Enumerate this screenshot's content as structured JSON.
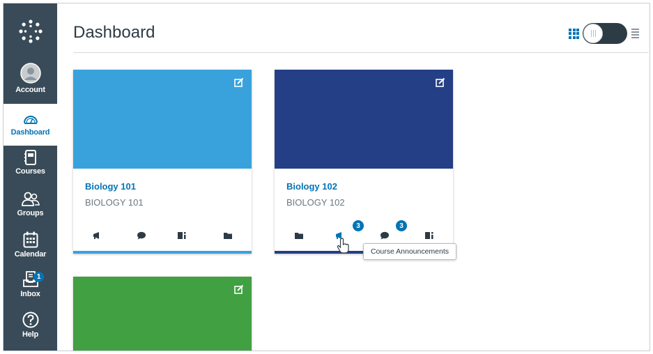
{
  "nav": {
    "items": [
      {
        "key": "account",
        "label": "Account",
        "icon": "account-icon"
      },
      {
        "key": "dashboard",
        "label": "Dashboard",
        "icon": "dashboard-icon",
        "active": true
      },
      {
        "key": "courses",
        "label": "Courses",
        "icon": "courses-icon"
      },
      {
        "key": "groups",
        "label": "Groups",
        "icon": "groups-icon"
      },
      {
        "key": "calendar",
        "label": "Calendar",
        "icon": "calendar-icon"
      },
      {
        "key": "inbox",
        "label": "Inbox",
        "icon": "inbox-icon",
        "badge": "1"
      },
      {
        "key": "help",
        "label": "Help",
        "icon": "help-icon"
      }
    ]
  },
  "header": {
    "title": "Dashboard"
  },
  "cards": [
    {
      "title": "Biology 101",
      "code": "BIOLOGY 101",
      "color": "#39a2dc",
      "actions": [
        "announcements-icon",
        "discussions-icon",
        "assignments-icon",
        "files-icon"
      ]
    },
    {
      "title": "Biology 102",
      "code": "BIOLOGY 102",
      "color": "#243f86",
      "actions": [
        "files-icon",
        "announcements-icon",
        "discussions-icon",
        "assignments-icon"
      ],
      "announcements_count": "3",
      "discussions_count": "3"
    },
    {
      "color": "#40a042"
    }
  ],
  "tooltip": {
    "text": "Course Announcements"
  },
  "colors": {
    "nav_bg": "#394b58",
    "link": "#0374b5",
    "badge": "#0374b5"
  }
}
